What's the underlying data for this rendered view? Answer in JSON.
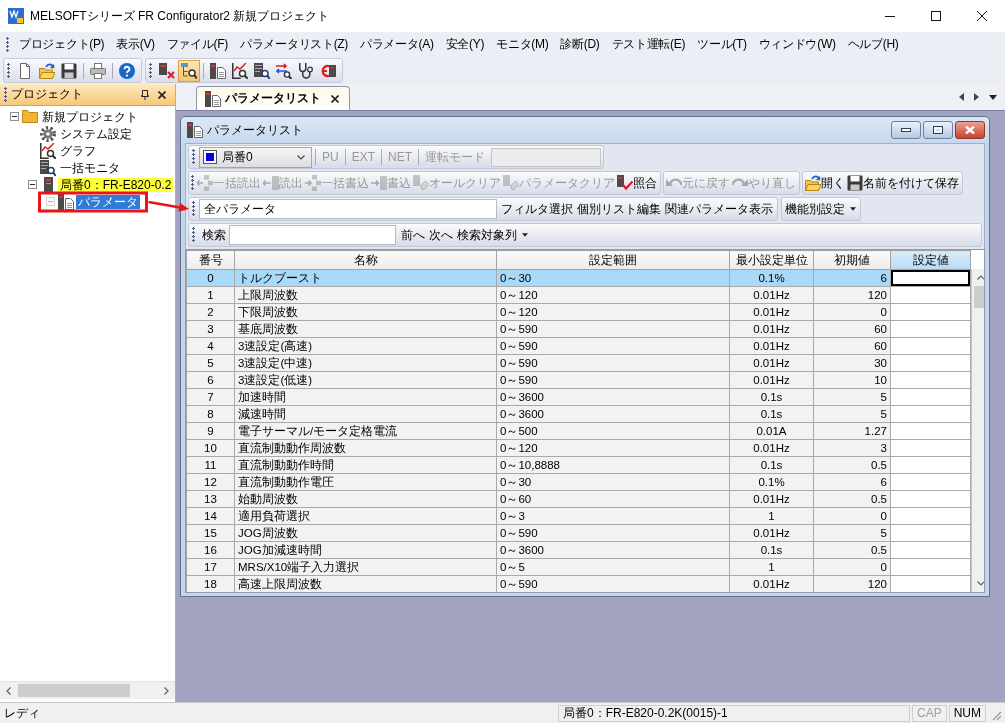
{
  "window": {
    "title": "MELSOFTシリーズ FR Configurator2 新規プロジェクト"
  },
  "menu": [
    "プロジェクト(P)",
    "表示(V)",
    "ファイル(F)",
    "パラメータリスト(Z)",
    "パラメータ(A)",
    "安全(Y)",
    "モニタ(M)",
    "診断(D)",
    "テスト運転(E)",
    "ツール(T)",
    "ウィンドウ(W)",
    "ヘルプ(H)"
  ],
  "toolbars": [
    {
      "sections": [
        {
          "buttons": [
            {
              "selected": false
            },
            {
              "selected": false
            },
            {
              "selected": false
            }
          ]
        },
        {
          "buttons": [
            {
              "selected": false
            }
          ]
        },
        {
          "buttons": [
            {
              "selected": false
            }
          ]
        }
      ]
    },
    {
      "sections": [
        {
          "buttons": [
            {
              "selected": false
            },
            {
              "selected": true
            }
          ]
        },
        {
          "buttons": [
            {
              "selected": false
            },
            {
              "selected": false
            },
            {
              "selected": false
            },
            {
              "selected": false
            },
            {
              "selected": false
            },
            {
              "selected": false
            }
          ]
        }
      ]
    }
  ],
  "project_panel": {
    "title": "プロジェクト",
    "tree": [
      {
        "label": "新規プロジェクト",
        "kind": "folder",
        "expanded": true,
        "selected": false,
        "highlighted": false,
        "children": [
          {
            "label": "システム設定",
            "kind": "settings",
            "expanded": false,
            "selected": false,
            "highlighted": false
          },
          {
            "label": "グラフ",
            "kind": "graph",
            "expanded": false,
            "selected": false,
            "highlighted": false
          },
          {
            "label": "一括モニタ",
            "kind": "monitor",
            "expanded": false,
            "selected": false,
            "highlighted": false
          },
          {
            "label": "局番0：FR-E820-0.2",
            "kind": "station",
            "expanded": true,
            "selected": false,
            "highlighted": true,
            "children": [
              {
                "label": "パラメータ",
                "kind": "parameters",
                "expanded": true,
                "selected": true,
                "highlighted": false
              }
            ]
          }
        ]
      }
    ]
  },
  "document_tabs": [
    {
      "label": "パラメータリスト",
      "selected": true
    }
  ],
  "child_window": {
    "title": "パラメータリスト",
    "station_bar": {
      "station": "局番0",
      "modes": [
        {
          "label": "PU",
          "disabled": true
        },
        {
          "label": "EXT",
          "disabled": true
        },
        {
          "label": "NET",
          "disabled": true
        }
      ],
      "operation_mode": {
        "label": "運転モード",
        "disabled": true
      }
    },
    "command_groups": [
      {
        "buttons": [
          {
            "label": "一括読出",
            "disabled": true
          },
          {
            "label": "読出",
            "disabled": true
          },
          {
            "label": "一括書込",
            "disabled": true
          },
          {
            "label": "書込",
            "disabled": true
          },
          {
            "label": "オールクリア",
            "disabled": true
          },
          {
            "label": "パラメータクリア",
            "disabled": true
          },
          {
            "label": "照合",
            "disabled": false
          }
        ]
      },
      {
        "buttons": [
          {
            "label": "元に戻す",
            "disabled": true
          },
          {
            "label": "やり直し",
            "disabled": true
          }
        ]
      },
      {
        "buttons": [
          {
            "label": "開く",
            "disabled": false
          },
          {
            "label": "名前を付けて保存",
            "disabled": false
          }
        ]
      }
    ],
    "filter_bar": {
      "list": "全パラメータ",
      "buttons": [
        "フィルタ選択",
        "個別リスト編集",
        "関連パラメータ表示"
      ],
      "function_menu": "機能別設定"
    },
    "search_bar": {
      "label": "検索",
      "buttons": [
        "前へ",
        "次へ"
      ],
      "column_menu": "検索対象列"
    },
    "table": {
      "columns": [
        {
          "label": "番号",
          "selected": false
        },
        {
          "label": "名称",
          "selected": false
        },
        {
          "label": "設定範囲",
          "selected": false
        },
        {
          "label": "最小設定単位",
          "selected": false
        },
        {
          "label": "初期値",
          "selected": false
        },
        {
          "label": "設定値",
          "selected": true
        }
      ],
      "rows": [
        {
          "number": "0",
          "name": "トルクブースト",
          "range": "0～30",
          "min_unit": "0.1%",
          "initial": "6",
          "selected": true,
          "editing": true
        },
        {
          "number": "1",
          "name": "上限周波数",
          "range": "0～120",
          "min_unit": "0.01Hz",
          "initial": "120",
          "selected": false,
          "editing": false
        },
        {
          "number": "2",
          "name": "下限周波数",
          "range": "0～120",
          "min_unit": "0.01Hz",
          "initial": "0",
          "selected": false,
          "editing": false
        },
        {
          "number": "3",
          "name": "基底周波数",
          "range": "0～590",
          "min_unit": "0.01Hz",
          "initial": "60",
          "selected": false,
          "editing": false
        },
        {
          "number": "4",
          "name": "3速設定(高速)",
          "range": "0～590",
          "min_unit": "0.01Hz",
          "initial": "60",
          "selected": false,
          "editing": false
        },
        {
          "number": "5",
          "name": "3速設定(中速)",
          "range": "0～590",
          "min_unit": "0.01Hz",
          "initial": "30",
          "selected": false,
          "editing": false
        },
        {
          "number": "6",
          "name": "3速設定(低速)",
          "range": "0～590",
          "min_unit": "0.01Hz",
          "initial": "10",
          "selected": false,
          "editing": false
        },
        {
          "number": "7",
          "name": "加速時間",
          "range": "0～3600",
          "min_unit": "0.1s",
          "initial": "5",
          "selected": false,
          "editing": false
        },
        {
          "number": "8",
          "name": "減速時間",
          "range": "0～3600",
          "min_unit": "0.1s",
          "initial": "5",
          "selected": false,
          "editing": false
        },
        {
          "number": "9",
          "name": "電子サーマル/モータ定格電流",
          "range": "0～500",
          "min_unit": "0.01A",
          "initial": "1.27",
          "selected": false,
          "editing": false
        },
        {
          "number": "10",
          "name": "直流制動動作周波数",
          "range": "0～120",
          "min_unit": "0.01Hz",
          "initial": "3",
          "selected": false,
          "editing": false
        },
        {
          "number": "11",
          "name": "直流制動動作時間",
          "range": "0～10,8888",
          "min_unit": "0.1s",
          "initial": "0.5",
          "selected": false,
          "editing": false
        },
        {
          "number": "12",
          "name": "直流制動動作電圧",
          "range": "0～30",
          "min_unit": "0.1%",
          "initial": "6",
          "selected": false,
          "editing": false
        },
        {
          "number": "13",
          "name": "始動周波数",
          "range": "0～60",
          "min_unit": "0.01Hz",
          "initial": "0.5",
          "selected": false,
          "editing": false
        },
        {
          "number": "14",
          "name": "適用負荷選択",
          "range": "0～3",
          "min_unit": "1",
          "initial": "0",
          "selected": false,
          "editing": false
        },
        {
          "number": "15",
          "name": "JOG周波数",
          "range": "0～590",
          "min_unit": "0.01Hz",
          "initial": "5",
          "selected": false,
          "editing": false
        },
        {
          "number": "16",
          "name": "JOG加減速時間",
          "range": "0～3600",
          "min_unit": "0.1s",
          "initial": "0.5",
          "selected": false,
          "editing": false
        },
        {
          "number": "17",
          "name": "MRS/X10端子入力選択",
          "range": "0～5",
          "min_unit": "1",
          "initial": "0",
          "selected": false,
          "editing": false
        },
        {
          "number": "18",
          "name": "高速上限周波数",
          "range": "0～590",
          "min_unit": "0.01Hz",
          "initial": "120",
          "selected": false,
          "editing": false
        }
      ]
    }
  },
  "status_bar": {
    "message": "レディ",
    "station": "局番0：FR-E820-0.2K(0015)-1",
    "indicators": [
      {
        "label": "CAP",
        "on": false
      },
      {
        "label": "NUM",
        "on": true
      }
    ]
  }
}
